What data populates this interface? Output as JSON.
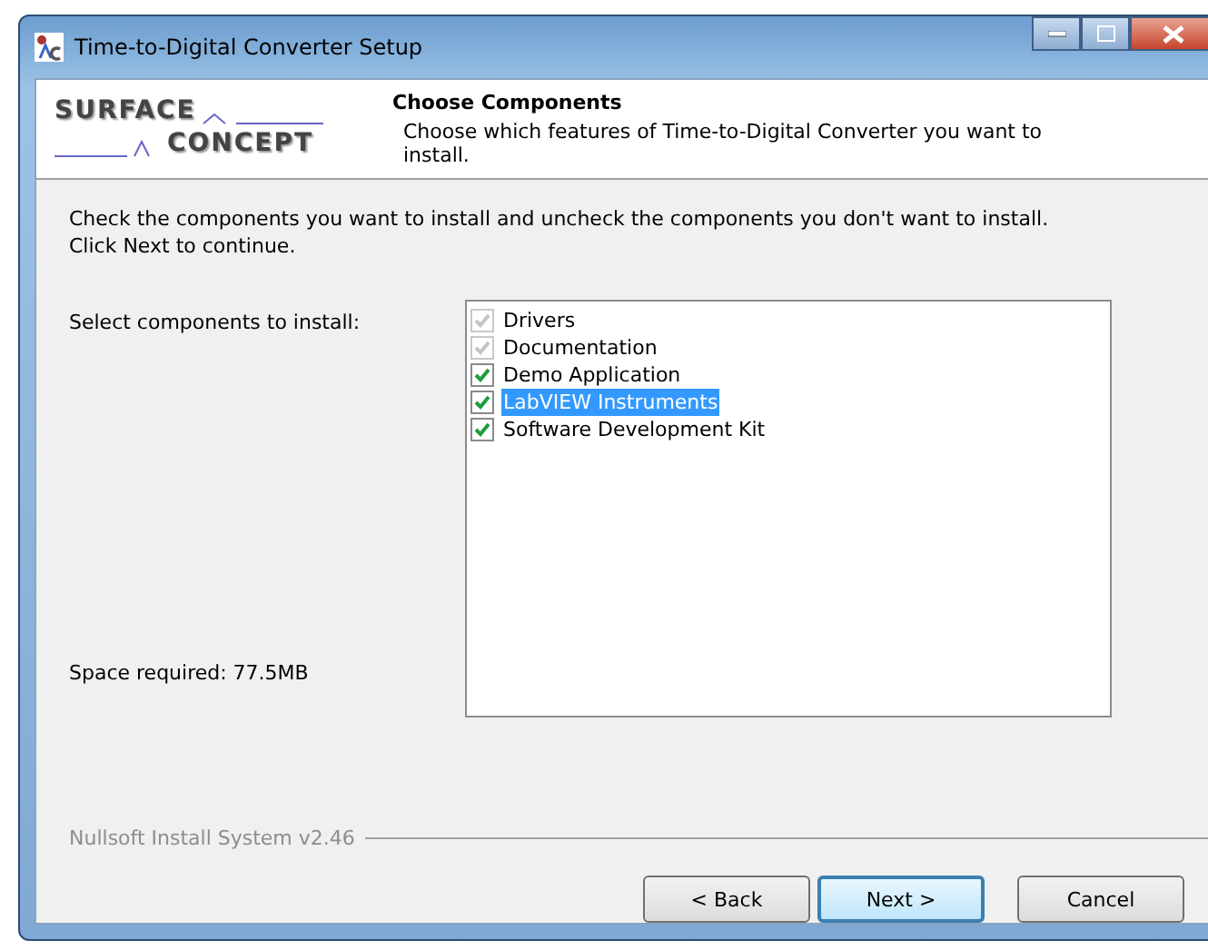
{
  "window": {
    "title": "Time-to-Digital Converter Setup"
  },
  "header": {
    "logo": [
      "SURFACE",
      "CONCEPT"
    ],
    "title": "Choose Components",
    "subtitle": "Choose which features of Time-to-Digital Converter you want to install."
  },
  "instructions": "Check the components you want to install and uncheck the components you don't want to install. Click Next to continue.",
  "select_label": "Select components to install:",
  "components": [
    {
      "label": "Drivers",
      "checked": true,
      "disabled": true,
      "selected": false
    },
    {
      "label": "Documentation",
      "checked": true,
      "disabled": true,
      "selected": false
    },
    {
      "label": "Demo Application",
      "checked": true,
      "disabled": false,
      "selected": false
    },
    {
      "label": "LabVIEW Instruments",
      "checked": true,
      "disabled": false,
      "selected": true
    },
    {
      "label": "Software Development Kit",
      "checked": true,
      "disabled": false,
      "selected": false
    }
  ],
  "space_required": "Space required: 77.5MB",
  "branding": "Nullsoft Install System v2.46",
  "buttons": [
    {
      "label": "< Back",
      "default": false
    },
    {
      "label": "Next >",
      "default": true
    },
    {
      "label": "Cancel",
      "default": false
    }
  ]
}
